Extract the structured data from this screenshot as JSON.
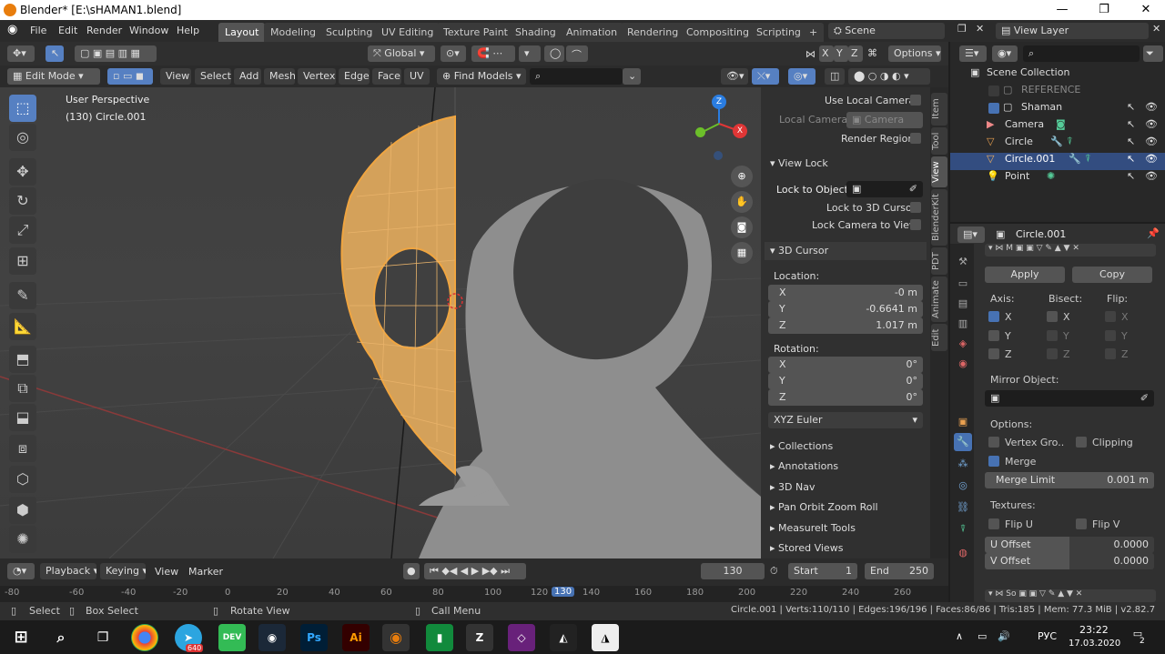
{
  "window": {
    "title": "Blender* [E:\\sHAMAN1.blend]",
    "minimize": "—",
    "maximize": "❐",
    "close": "✕"
  },
  "menu": {
    "file": "File",
    "edit": "Edit",
    "render": "Render",
    "window": "Window",
    "help": "Help"
  },
  "workspaces": [
    "Layout",
    "Modeling",
    "Sculpting",
    "UV Editing",
    "Texture Paint",
    "Shading",
    "Animation",
    "Rendering",
    "Compositing",
    "Scripting"
  ],
  "workspace_add": "+",
  "scene": {
    "name": "Scene",
    "view_layer": "View Layer"
  },
  "header": {
    "transform_orientation": "Global",
    "axes": [
      "X",
      "Y",
      "Z"
    ],
    "options": "Options"
  },
  "viewport_header": {
    "mode": "Edit Mode",
    "view": "View",
    "select": "Select",
    "add": "Add",
    "mesh": "Mesh",
    "vertex": "Vertex",
    "edge": "Edge",
    "face": "Face",
    "uv": "UV",
    "find_models": "Find Models",
    "search_placeholder": ""
  },
  "viewport": {
    "perspective": "User Perspective",
    "object": "(130) Circle.001",
    "gizmo": {
      "x": "X",
      "y": "Y",
      "z": "Z"
    }
  },
  "npanel": {
    "use_local_camera": "Use Local Camera",
    "local_camera": "Local Camera",
    "camera": "Camera",
    "render_region": "Render Region",
    "view_lock": "View Lock",
    "lock_to_object": "Lock to Object",
    "lock_to_cursor": "Lock to 3D Cursor",
    "lock_camera": "Lock Camera to View",
    "cursor_section": "3D Cursor",
    "location": "Location:",
    "rotation": "Rotation:",
    "loc": [
      {
        "axis": "X",
        "value": "-0 m"
      },
      {
        "axis": "Y",
        "value": "-0.6641 m"
      },
      {
        "axis": "Z",
        "value": "1.017 m"
      }
    ],
    "rot": [
      {
        "axis": "X",
        "value": "0°"
      },
      {
        "axis": "Y",
        "value": "0°"
      },
      {
        "axis": "Z",
        "value": "0°"
      }
    ],
    "rotation_mode": "XYZ Euler",
    "sections": [
      "Collections",
      "Annotations",
      "3D Nav",
      "Pan Orbit Zoom Roll",
      "MeasureIt Tools",
      "Stored Views"
    ]
  },
  "ntabs": [
    "Item",
    "Tool",
    "View",
    "BlenderKit",
    "PDT",
    "Animate",
    "Edit"
  ],
  "outliner": {
    "root": "Scene Collection",
    "items": [
      {
        "name": "REFERENCE"
      },
      {
        "name": "Shaman"
      },
      {
        "name": "Camera"
      },
      {
        "name": "Circle"
      },
      {
        "name": "Circle.001"
      },
      {
        "name": "Point"
      }
    ]
  },
  "properties": {
    "object": "Circle.001",
    "apply": "Apply",
    "copy": "Copy",
    "axis": "Axis:",
    "bisect": "Bisect:",
    "flip": "Flip:",
    "x": "X",
    "y": "Y",
    "z": "Z",
    "mirror_object": "Mirror Object:",
    "options": "Options:",
    "vertex_groups": "Vertex Gro..",
    "clipping": "Clipping",
    "merge": "Merge",
    "merge_limit": "Merge Limit",
    "merge_limit_value": "0.001 m",
    "textures": "Textures:",
    "flip_u": "Flip U",
    "flip_v": "Flip V",
    "u_offset": "U Offset",
    "u_offset_value": "0.0000",
    "v_offset": "V Offset",
    "v_offset_value": "0.0000"
  },
  "timeline": {
    "playback": "Playback",
    "keying": "Keying",
    "view": "View",
    "marker": "Marker",
    "current_frame": "130",
    "start_label": "Start",
    "start": "1",
    "end_label": "End",
    "end": "250",
    "ticks": [
      "-80",
      "-60",
      "-40",
      "-20",
      "0",
      "20",
      "40",
      "60",
      "80",
      "100",
      "120",
      "130",
      "140",
      "160",
      "180",
      "200",
      "220",
      "240",
      "260"
    ]
  },
  "status": {
    "select": "Select",
    "box_select": "Box Select",
    "rotate_view": "Rotate View",
    "call_menu": "Call Menu",
    "stats": "Circle.001 | Verts:110/110 | Edges:196/196 | Faces:86/86 | Tris:185 | Mem: 77.3 MiB | v2.82.7"
  },
  "taskbar": {
    "lang": "РУС",
    "time": "23:22",
    "date": "17.03.2020",
    "notifications": "2",
    "telegram_badge": "640"
  }
}
